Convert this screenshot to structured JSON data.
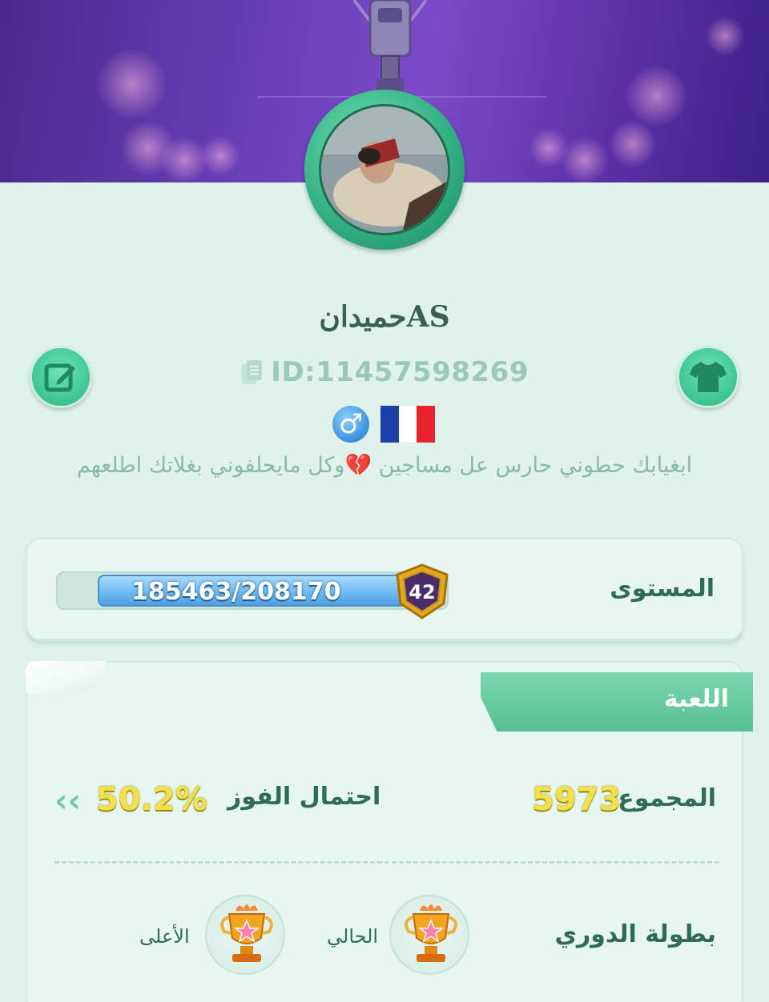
{
  "profile": {
    "username": "حميدانAS",
    "id_text": "ID:11457598269",
    "bio": "ابغيابك حطوني حارس عل مساجين 💔وكل مايحلفوني بغلاتك اطلعهم",
    "gender_symbol": "♂",
    "flag": {
      "country": "France",
      "colors": [
        "#1f3fa8",
        "#ffffff",
        "#e8242e"
      ]
    }
  },
  "level": {
    "label": "المستوى",
    "xp_text": "185463/208170",
    "xp_current": 185463,
    "xp_total": 208170,
    "level_number": "42"
  },
  "game": {
    "tab_label": "اللعبة",
    "total_label": "المجموع",
    "total_value": "5973",
    "winrate_label": "احتمال الفوز",
    "winrate_value": "50.2%",
    "league_label": "بطولة الدوري",
    "current_label": "الحالي",
    "highest_label": "الأعلى"
  },
  "colors": {
    "accent_green": "#3cc491",
    "text_green": "#2f6b58",
    "gold": "#f4e14a",
    "xp_blue": "#6db8f2",
    "banner_purple": "#6a3fb8"
  },
  "icons": {
    "edit": "edit-icon",
    "shirt": "shirt-icon",
    "copy": "copy-icon",
    "male": "male-icon",
    "chevron": "chevron-left-icon",
    "trophy": "trophy-icon"
  }
}
